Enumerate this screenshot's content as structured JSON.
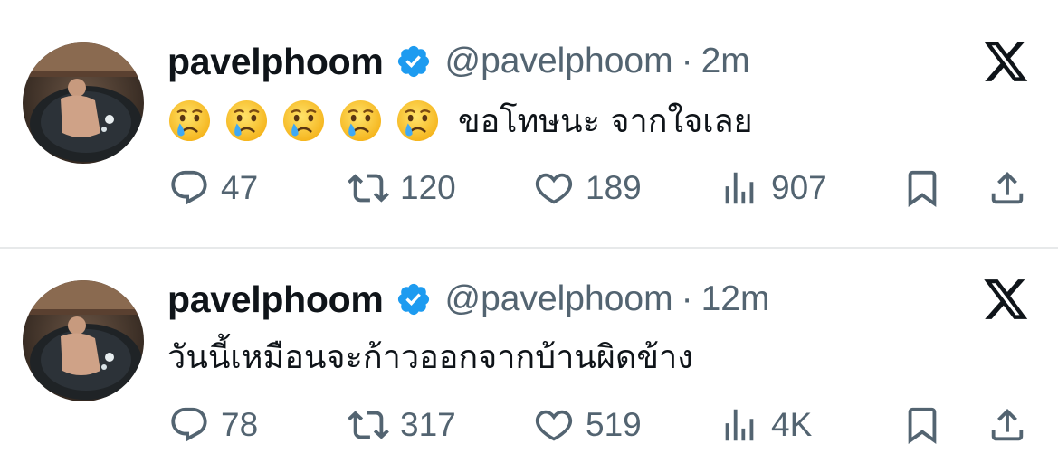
{
  "colors": {
    "text_primary": "#0f1419",
    "text_secondary": "#536471",
    "verified_blue": "#1d9bf0",
    "divider": "#e7e9ea"
  },
  "tweets": [
    {
      "name": "pavelphoom",
      "handle": "@pavelphoom",
      "separator": "·",
      "time": "2m",
      "verified": true,
      "emojis": [
        "crying-face",
        "crying-face",
        "crying-face",
        "crying-face",
        "crying-face"
      ],
      "text": "ขอโทษนะ จากใจเลย",
      "replies": "47",
      "retweets": "120",
      "likes": "189",
      "views": "907"
    },
    {
      "name": "pavelphoom",
      "handle": "@pavelphoom",
      "separator": "·",
      "time": "12m",
      "verified": true,
      "emojis": [],
      "text": "วันนี้เหมือนจะก้าวออกจากบ้านผิดข้าง",
      "replies": "78",
      "retweets": "317",
      "likes": "519",
      "views": "4K"
    }
  ],
  "icons": {
    "reply": "speech-bubble-icon",
    "retweet": "retweet-arrows-icon",
    "like": "heart-icon",
    "views": "bar-chart-icon",
    "bookmark": "bookmark-icon",
    "share": "share-upload-icon",
    "brand": "x-logo-icon",
    "verified": "verified-badge-icon"
  }
}
